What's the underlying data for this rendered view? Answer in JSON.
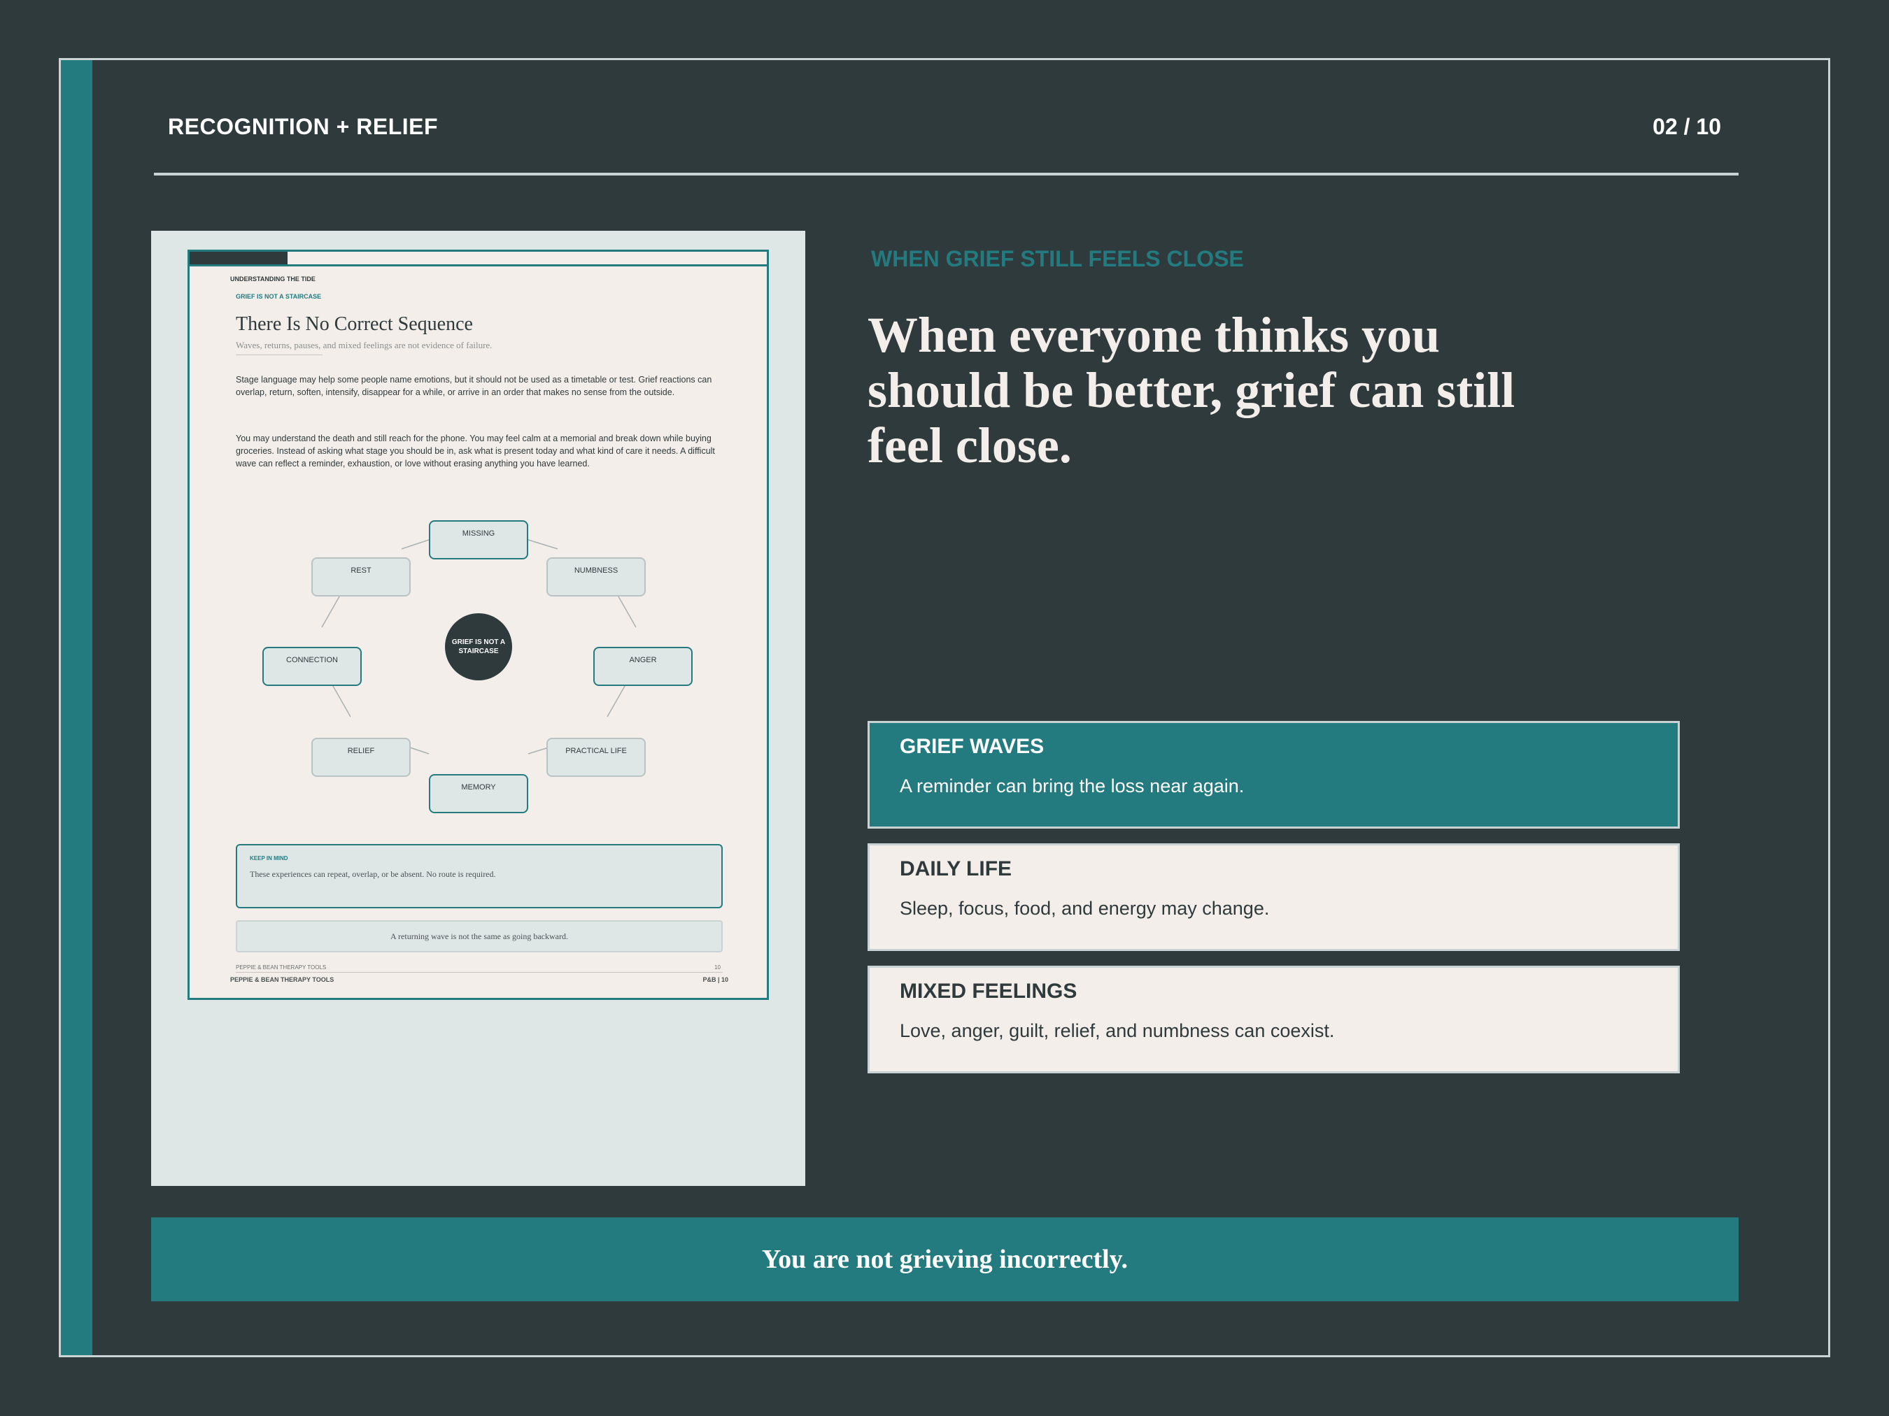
{
  "header": {
    "kicker": "RECOGNITION + RELIEF",
    "page_count": "02 / 10"
  },
  "preview": {
    "kicker": "UNDERSTANDING THE TIDE",
    "subkicker": "GRIEF IS NOT A STAIRCASE",
    "title": "There Is No Correct Sequence",
    "subtitle": "Waves, returns, pauses, and mixed feelings are not evidence of failure.",
    "paragraphs": [
      "Stage language may help some people name emotions, but it should not be used as a timetable or test. Grief reactions can overlap, return, soften, intensify, disappear for a while, or arrive in an order that makes no sense from the outside.",
      "You may understand the death and still reach for the phone. You may feel calm at a memorial and break down while buying groceries. Instead of asking what stage you should be in, ask what is present today and what kind of care it needs. A difficult wave can reflect a reminder, exhaustion, or love without erasing anything you have learned."
    ],
    "diagram": {
      "center": "GRIEF IS NOT A STAIRCASE",
      "nodes": [
        "MISSING",
        "NUMBNESS",
        "ANGER",
        "PRACTICAL LIFE",
        "MEMORY",
        "RELIEF",
        "CONNECTION",
        "REST"
      ]
    },
    "keep_in_mind": {
      "label": "KEEP IN MIND",
      "text": "These experiences can repeat, overlap, or be absent. No route is required."
    },
    "quote": "A returning wave is not the same as going backward.",
    "footer_inner": {
      "brand": "PEPPIE & BEAN THERAPY TOOLS",
      "page": "10"
    },
    "footer": {
      "brand": "PEPPIE & BEAN THERAPY TOOLS",
      "page": "P&B  |  10"
    }
  },
  "main": {
    "kicker": "WHEN GRIEF STILL FEELS CLOSE",
    "headline": "When everyone thinks you should be better, grief can still feel close.",
    "cards": [
      {
        "title": "GRIEF WAVES",
        "text": "A reminder can bring the loss near again."
      },
      {
        "title": "DAILY LIFE",
        "text": "Sleep, focus, food, and energy may change."
      },
      {
        "title": "MIXED FEELINGS",
        "text": "Love, anger, guilt, relief, and numbness can coexist."
      }
    ]
  },
  "banner": "You are not grieving incorrectly.",
  "colors": {
    "background": "#2f3a3d",
    "accent": "#237b80",
    "cream": "#f3eee9",
    "pale": "#dfe7e6"
  }
}
